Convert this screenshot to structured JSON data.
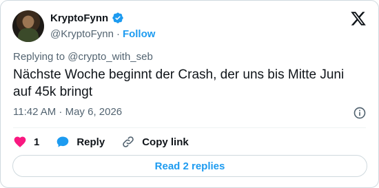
{
  "author": {
    "name": "KryptoFynn",
    "handle": "@KryptoFynn",
    "separator": "·",
    "follow_label": "Follow"
  },
  "reply_context": "Replying to @crypto_with_seb",
  "tweet": {
    "text": "Nächste Woche beginnt der Crash, der uns bis Mitte Juni auf 45k bringt",
    "timestamp": "11:42 AM · May 6, 2026"
  },
  "actions": {
    "like_count": "1",
    "reply_label": "Reply",
    "copy_link_label": "Copy link"
  },
  "read_replies_label": "Read 2 replies",
  "colors": {
    "accent": "#1d9bf0",
    "like": "#f91880",
    "text": "#0f1419",
    "muted": "#536471"
  }
}
